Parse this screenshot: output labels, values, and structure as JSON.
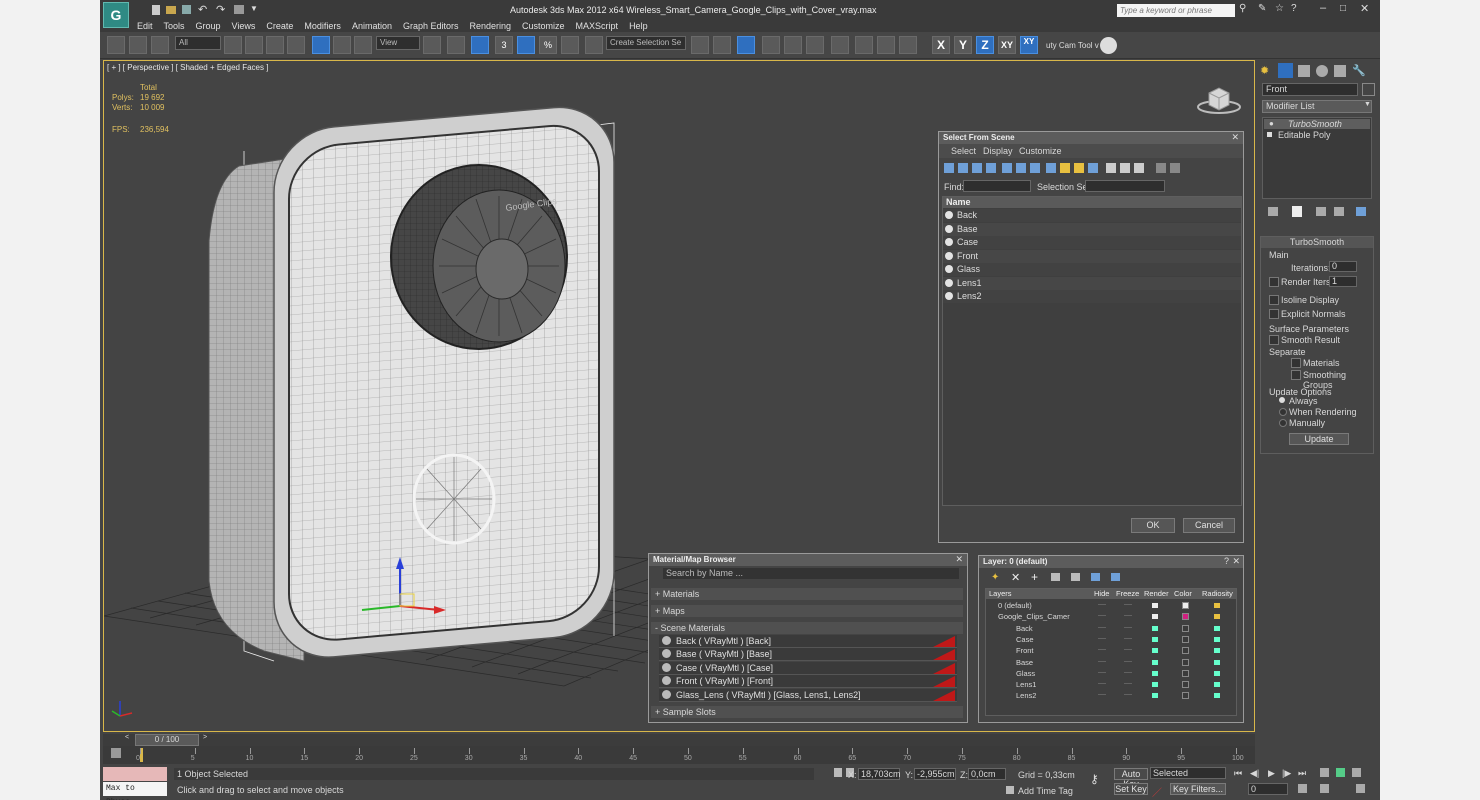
{
  "app": {
    "title": "Autodesk 3ds Max  2012 x64     Wireless_Smart_Camera_Google_Clips_with_Cover_vray.max",
    "search_placeholder": "Type a keyword or phrase",
    "logo_letter": "G"
  },
  "menu": [
    "Edit",
    "Tools",
    "Group",
    "Views",
    "Create",
    "Modifiers",
    "Animation",
    "Graph Editors",
    "Rendering",
    "Customize",
    "MAXScript",
    "Help"
  ],
  "toolbar": {
    "filter_value": "All",
    "view_value": "View",
    "snap_label": "3",
    "percent_snap_label": "%",
    "selection_set_value": "Create Selection Se",
    "axis_x": "X",
    "axis_y": "Y",
    "axis_z": "Z",
    "axis_xy": "XY",
    "axis_xy_active": "XY",
    "cam_tool_label": "uty Cam Tool v"
  },
  "viewport": {
    "label": "[ + ] [ Perspective ] [ Shaded + Edged Faces ]",
    "stats": {
      "total_label": "Total",
      "polys_label": "Polys:",
      "polys_value": "19 692",
      "verts_label": "Verts:",
      "verts_value": "10 009",
      "fps_label": "FPS:",
      "fps_value": "236,594"
    },
    "camera_lens_text": "Google Clips"
  },
  "select_from_scene": {
    "title": "Select From Scene",
    "menu": [
      "Select",
      "Display",
      "Customize"
    ],
    "find_label": "Find:",
    "selection_set_label": "Selection Set:",
    "column_name": "Name",
    "items": [
      "Back",
      "Base",
      "Case",
      "Front",
      "Glass",
      "Lens1",
      "Lens2"
    ],
    "ok_label": "OK",
    "cancel_label": "Cancel"
  },
  "material_browser": {
    "title": "Material/Map Browser",
    "search_placeholder": "Search by Name ...",
    "sections": [
      "+ Materials",
      "+ Maps",
      "- Scene Materials"
    ],
    "scene_materials": [
      "Back  ( VRayMtl ) [Back]",
      "Base  ( VRayMtl ) [Base]",
      "Case  ( VRayMtl ) [Case]",
      "Front  ( VRayMtl ) [Front]",
      "Glass_Lens  ( VRayMtl ) [Glass, Lens1, Lens2]"
    ],
    "sample_slots": "+ Sample Slots"
  },
  "layer_dialog": {
    "title": "Layer: 0 (default)",
    "help_label": "?",
    "columns": [
      "Layers",
      "Hide",
      "Freeze",
      "Render",
      "Color",
      "Radiosity"
    ],
    "rows": [
      "0 (default)",
      "Google_Clips_Camer",
      "Back",
      "Case",
      "Front",
      "Base",
      "Glass",
      "Lens1",
      "Lens2"
    ],
    "dash": "----"
  },
  "command_panel": {
    "object_name": "Front",
    "modifier_list": "Modifier List",
    "stack": [
      "TurboSmooth",
      "Editable Poly"
    ],
    "rollout_title": "TurboSmooth",
    "main_label": "Main",
    "iterations_label": "Iterations:",
    "iterations_value": "0",
    "render_iters_label": "Render Iters:",
    "render_iters_value": "1",
    "isoline_label": "Isoline Display",
    "explicit_normals_label": "Explicit Normals",
    "surface_params_label": "Surface Parameters",
    "smooth_result_label": "Smooth Result",
    "separate_label": "Separate",
    "materials_label": "Materials",
    "smoothing_groups_label": "Smoothing Groups",
    "update_options_label": "Update Options",
    "always_label": "Always",
    "when_rendering_label": "When Rendering",
    "manually_label": "Manually",
    "update_button": "Update"
  },
  "timeline": {
    "frame_display": "0 / 100",
    "ticks": [
      "0",
      "5",
      "10",
      "15",
      "20",
      "25",
      "30",
      "35",
      "40",
      "45",
      "50",
      "55",
      "60",
      "65",
      "70",
      "75",
      "80",
      "85",
      "90",
      "95",
      "100"
    ]
  },
  "status": {
    "maxscript_label": "Max to Physc.",
    "selected_text": "1 Object Selected",
    "prompt_text": "Click and drag to select and move objects",
    "x_label": "X:",
    "x_value": "18,703cm",
    "y_label": "Y:",
    "y_value": "-2,955cm",
    "z_label": "Z:",
    "z_value": "0,0cm",
    "grid_text": "Grid = 0,33cm",
    "add_time_tag": "Add Time Tag",
    "auto_key": "Auto Key",
    "set_key": "Set Key",
    "selected_dropdown": "Selected",
    "key_filters": "Key Filters...",
    "frame_value": "0"
  }
}
